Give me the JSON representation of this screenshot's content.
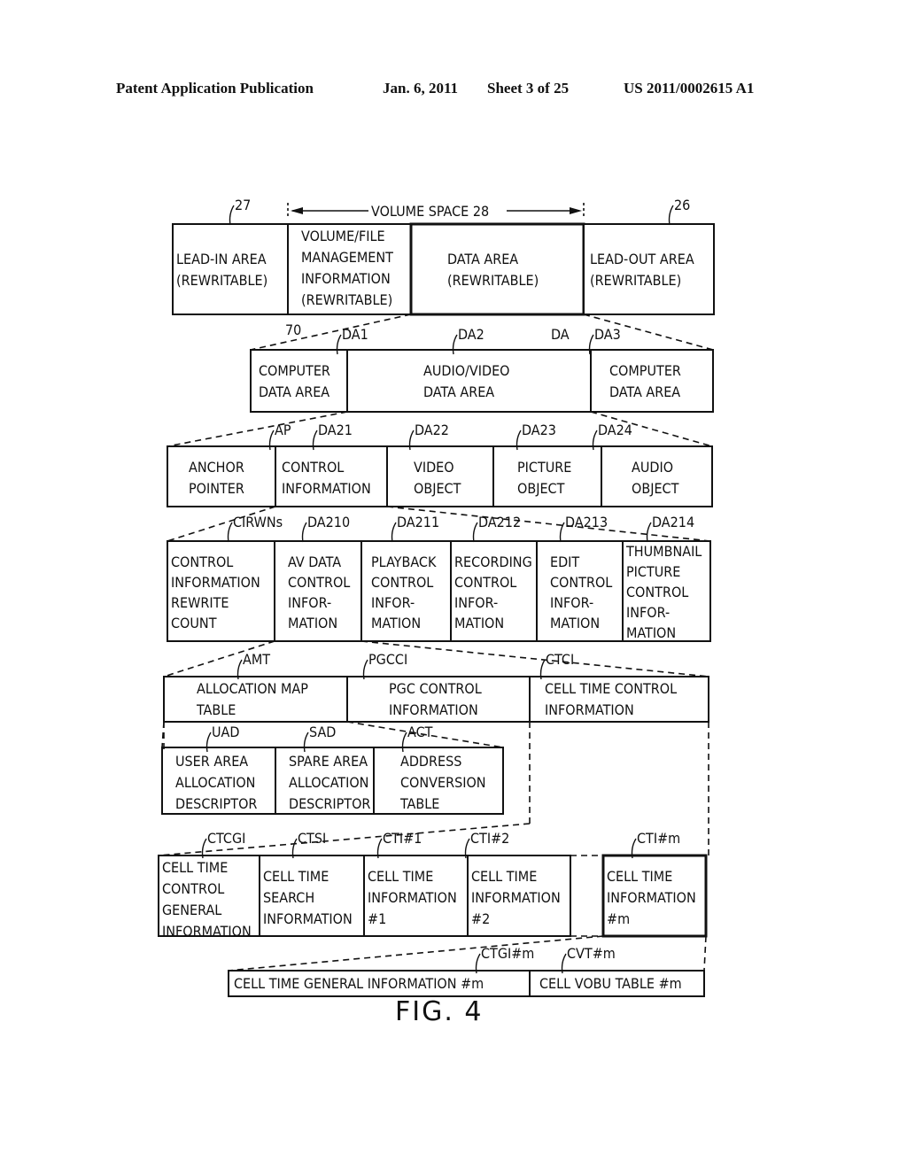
{
  "header": {
    "publication": "Patent Application Publication",
    "date": "Jan. 6, 2011",
    "sheet": "Sheet 3 of 25",
    "number": "US 2011/0002615 A1"
  },
  "figure_label": "FIG. 4",
  "volume_space_label": "VOLUME SPACE 28",
  "levels": [
    {
      "id": "disc",
      "cells": [
        {
          "ref": "27",
          "lines": [
            "LEAD-IN AREA",
            "(REWRITABLE)"
          ]
        },
        {
          "ref": "70",
          "lines": [
            "VOLUME/FILE",
            "MANAGEMENT",
            "INFORMATION",
            "(REWRITABLE)"
          ]
        },
        {
          "ref": "DA",
          "lines": [
            "DATA AREA",
            "(REWRITABLE)"
          ]
        },
        {
          "ref": "26",
          "lines": [
            "LEAD-OUT AREA",
            "(REWRITABLE)"
          ]
        }
      ]
    },
    {
      "id": "data-area",
      "cells": [
        {
          "ref": "DA1",
          "lines": [
            "COMPUTER",
            "DATA AREA"
          ]
        },
        {
          "ref": "DA2",
          "lines": [
            "AUDIO/VIDEO",
            "DATA AREA"
          ]
        },
        {
          "ref": "DA3",
          "lines": [
            "COMPUTER",
            "DATA AREA"
          ]
        }
      ]
    },
    {
      "id": "av-data-area",
      "cells": [
        {
          "ref": "AP",
          "lines": [
            "ANCHOR",
            "POINTER"
          ]
        },
        {
          "ref": "DA21",
          "lines": [
            "CONTROL",
            "INFORMATION"
          ]
        },
        {
          "ref": "DA22",
          "lines": [
            "VIDEO",
            "OBJECT"
          ]
        },
        {
          "ref": "DA23",
          "lines": [
            "PICTURE",
            "OBJECT"
          ]
        },
        {
          "ref": "DA24",
          "lines": [
            "AUDIO",
            "OBJECT"
          ]
        }
      ]
    },
    {
      "id": "control-information",
      "cells": [
        {
          "ref": "CIRWNs",
          "lines": [
            "CONTROL",
            "INFORMATION",
            "REWRITE",
            "COUNT"
          ]
        },
        {
          "ref": "DA210",
          "lines": [
            "AV DATA",
            "CONTROL",
            "INFOR-",
            "MATION"
          ]
        },
        {
          "ref": "DA211",
          "lines": [
            "PLAYBACK",
            "CONTROL",
            "INFOR-",
            "MATION"
          ]
        },
        {
          "ref": "DA212",
          "lines": [
            "RECORDING",
            "CONTROL",
            "INFOR-",
            "MATION"
          ]
        },
        {
          "ref": "DA213",
          "lines": [
            "EDIT",
            "CONTROL",
            "INFOR-",
            "MATION"
          ]
        },
        {
          "ref": "DA214",
          "lines": [
            "THUMBNAIL",
            "PICTURE",
            "CONTROL",
            "INFOR-",
            "MATION"
          ]
        }
      ]
    },
    {
      "id": "av-data-control",
      "cells": [
        {
          "ref": "AMT",
          "lines": [
            "ALLOCATION MAP",
            "TABLE"
          ]
        },
        {
          "ref": "PGCCI",
          "lines": [
            "PGC CONTROL",
            "INFORMATION"
          ]
        },
        {
          "ref": "CTCI",
          "lines": [
            "CELL TIME CONTROL",
            "INFORMATION"
          ]
        }
      ]
    },
    {
      "id": "allocation-map",
      "cells": [
        {
          "ref": "UAD",
          "lines": [
            "USER AREA",
            "ALLOCATION",
            "DESCRIPTOR"
          ]
        },
        {
          "ref": "SAD",
          "lines": [
            "SPARE AREA",
            "ALLOCATION",
            "DESCRIPTOR"
          ]
        },
        {
          "ref": "ACT",
          "lines": [
            "ADDRESS",
            "CONVERSION",
            "TABLE"
          ]
        }
      ]
    },
    {
      "id": "cell-time-control",
      "cells": [
        {
          "ref": "CTCGI",
          "lines": [
            "CELL TIME",
            "CONTROL",
            "GENERAL",
            "INFORMATION"
          ]
        },
        {
          "ref": "CTSI",
          "lines": [
            "CELL TIME",
            "SEARCH",
            "INFORMATION"
          ]
        },
        {
          "ref": "CTI#1",
          "lines": [
            "CELL TIME",
            "INFORMATION",
            "#1"
          ]
        },
        {
          "ref": "CTI#2",
          "lines": [
            "CELL TIME",
            "INFORMATION",
            "#2"
          ]
        },
        {
          "ref": "CTI#m",
          "lines": [
            "CELL TIME",
            "INFORMATION",
            "#m"
          ]
        }
      ]
    },
    {
      "id": "cell-time-info",
      "cells": [
        {
          "ref": "CTGI#m",
          "lines": [
            "CELL TIME GENERAL INFORMATION #m"
          ]
        },
        {
          "ref": "CVT#m",
          "lines": [
            "CELL VOBU TABLE #m"
          ]
        }
      ]
    }
  ]
}
